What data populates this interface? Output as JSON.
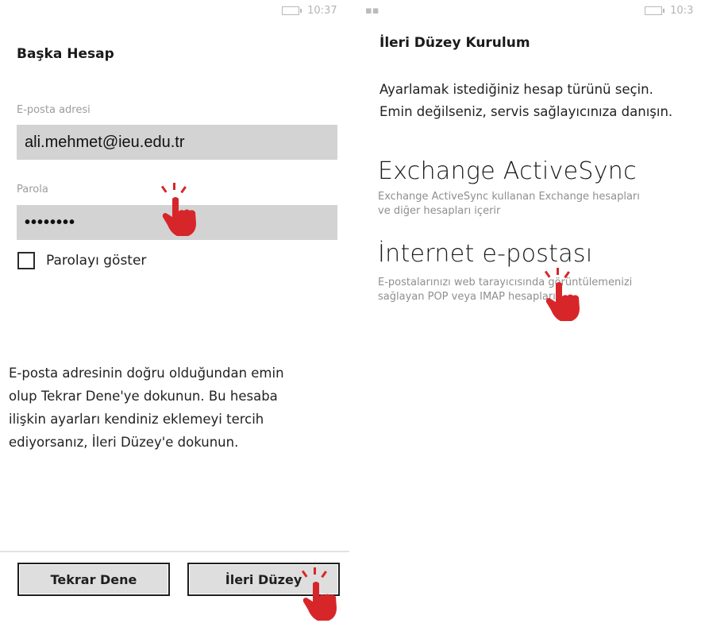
{
  "left_screen": {
    "status_time": "10:37",
    "title": "Başka Hesap",
    "email_label": "E-posta adresi",
    "email_value": "ali.mehmet@ieu.edu.tr",
    "password_label": "Parola",
    "password_value": "••••••••",
    "show_password_label": "Parolayı göster",
    "help_lines": [
      "E-posta adresinin doğru olduğundan emin",
      "olup Tekrar Dene'ye dokunun. Bu hesaba",
      "ilişkin ayarları kendiniz eklemeyi tercih",
      "ediyorsanız, İleri Düzey'e dokunun."
    ],
    "retry_button": "Tekrar Dene",
    "advanced_button": "İleri Düzey"
  },
  "right_screen": {
    "status_time": "10:3",
    "title": "İleri Düzey Kurulum",
    "desc_line1": "Ayarlamak istediğiniz hesap türünü seçin.",
    "desc_line2": "Emin değilseniz, servis sağlayıcınıza danışın.",
    "options": [
      {
        "title": "Exchange ActiveSync",
        "desc_line1": "Exchange ActiveSync kullanan Exchange hesapları",
        "desc_line2": "ve diğer hesapları içerir"
      },
      {
        "title": "İnternet e-postası",
        "desc_line1": "E-postalarınızı web tarayıcısında görüntülemenizi",
        "desc_line2": "sağlayan POP veya IMAP hesapları"
      }
    ]
  },
  "colors": {
    "field_bg": "#d3d3d3",
    "button_bg": "#dedede",
    "hand_red": "#d7262a",
    "muted_text": "#9c9c9c"
  },
  "icons": {
    "battery": "battery-icon",
    "signal": "signal-icon",
    "tap_gesture": "tap-hand-icon"
  }
}
